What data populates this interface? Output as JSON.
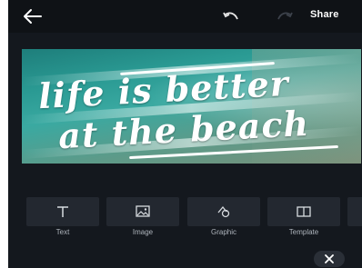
{
  "topbar": {
    "share_label": "Share"
  },
  "canvas": {
    "quote_line1": "life is better",
    "quote_line2": "at the beach"
  },
  "tools": [
    {
      "label": "Text",
      "icon": "text-icon"
    },
    {
      "label": "Image",
      "icon": "image-icon"
    },
    {
      "label": "Graphic",
      "icon": "graphic-icon"
    },
    {
      "label": "Template",
      "icon": "template-icon"
    }
  ],
  "colors": {
    "background": "#14181e",
    "topbar": "#0f1216",
    "tile": "#232830",
    "label": "#aeb4bc"
  }
}
